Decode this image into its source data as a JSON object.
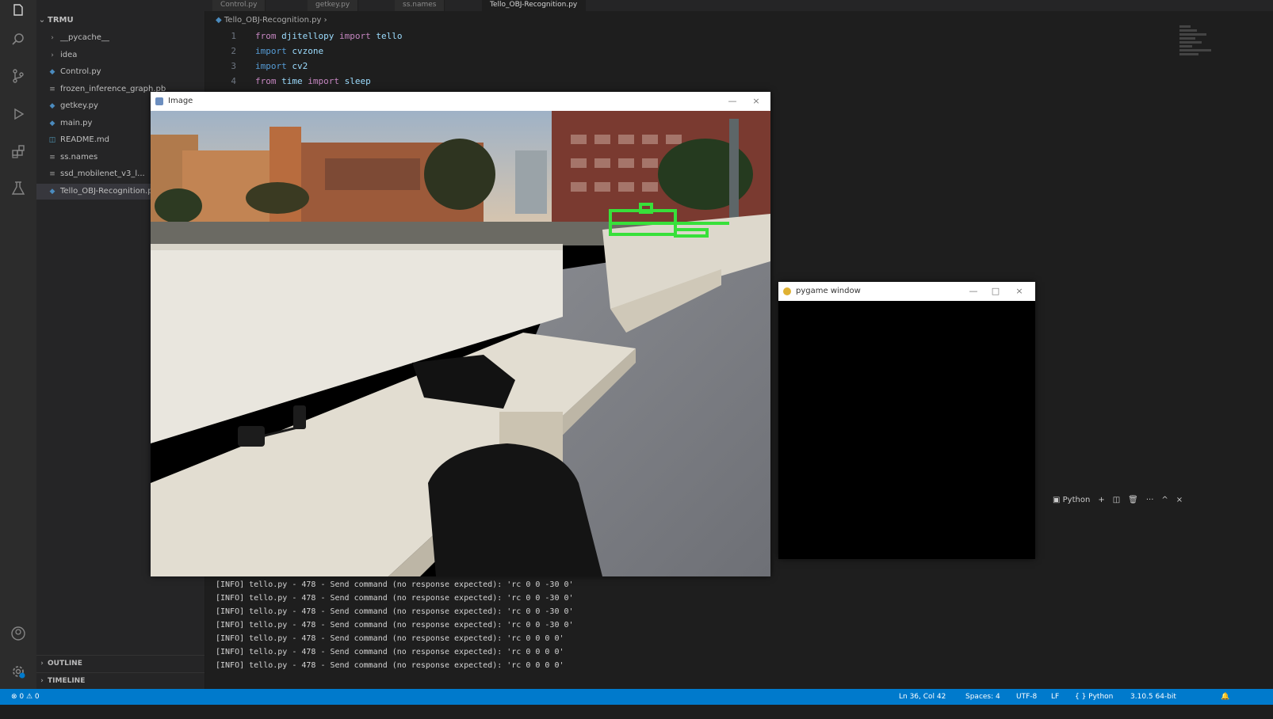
{
  "explorer": {
    "root": "TRMU",
    "items": [
      {
        "label": "__pycache__",
        "icon": "folder-icon",
        "type": "folder"
      },
      {
        "label": "idea",
        "icon": "folder-icon",
        "type": "folder"
      },
      {
        "label": "Control.py",
        "icon": "python-icon",
        "type": "file"
      },
      {
        "label": "frozen_inference_graph.pb",
        "icon": "file-icon",
        "type": "file"
      },
      {
        "label": "getkey.py",
        "icon": "python-icon",
        "type": "file"
      },
      {
        "label": "main.py",
        "icon": "python-icon",
        "type": "file"
      },
      {
        "label": "README.md",
        "icon": "markdown-icon",
        "type": "file"
      },
      {
        "label": "ss.names",
        "icon": "file-icon",
        "type": "file"
      },
      {
        "label": "ssd_mobilenet_v3_l...",
        "icon": "file-icon",
        "type": "file"
      },
      {
        "label": "Tello_OBJ-Recognition.py",
        "icon": "python-icon",
        "type": "file",
        "selected": true
      }
    ],
    "outline_label": "OUTLINE",
    "timeline_label": "TIMELINE"
  },
  "editor": {
    "tabs": [
      {
        "label": "Control.py",
        "active": false
      },
      {
        "label": "getkey.py",
        "active": false
      },
      {
        "label": "ss.names",
        "active": false
      },
      {
        "label": "Tello_OBJ-Recognition.py",
        "active": true
      }
    ],
    "breadcrumb": "Tello_OBJ-Recognition.py",
    "lines": [
      {
        "n": "1",
        "a": "from ",
        "b": "djitellopy",
        "c": " import ",
        "d": "tello"
      },
      {
        "n": "2",
        "a": "import ",
        "b": "cvzone",
        "c": "",
        "d": ""
      },
      {
        "n": "3",
        "a": "import ",
        "b": "cv2",
        "c": "",
        "d": ""
      },
      {
        "n": "4",
        "a": "from ",
        "b": "time",
        "c": " import ",
        "d": "sleep"
      }
    ]
  },
  "terminal": {
    "lines": [
      "[INFO] tello.py - 478 - Send command (no response expected): 'rc 0 0 -30 0'",
      "[INFO] tello.py - 478 - Send command (no response expected): 'rc 0 0 -30 0'",
      "[INFO] tello.py - 478 - Send command (no response expected): 'rc 0 0 -30 0'",
      "[INFO] tello.py - 478 - Send command (no response expected): 'rc 0 0 -30 0'",
      "[INFO] tello.py - 478 - Send command (no response expected): 'rc 0 0 0 0'",
      "[INFO] tello.py - 478 - Send command (no response expected): 'rc 0 0 0 0'",
      "[INFO] tello.py - 478 - Send command (no response expected): 'rc 0 0 0 0'"
    ],
    "toolbar": {
      "shell": "Python",
      "plus": "+",
      "split": "◫",
      "trash": "🗑",
      "more": "···",
      "maximize": "^",
      "close": "×"
    }
  },
  "statusbar": {
    "left": "⊗ 0 ⚠ 0",
    "position": "Ln 36, Col 42",
    "spaces": "Spaces: 4",
    "encoding": "UTF-8",
    "eol": "LF",
    "language": "{ } Python",
    "interpreter": "3.10.5 64-bit"
  },
  "windows": {
    "video": {
      "title": "Image",
      "minimize": "—",
      "close": "×"
    },
    "pygame": {
      "title": "pygame window",
      "minimize": "—",
      "maximize": "□",
      "close": "×"
    }
  },
  "colors": {
    "detection_box": "#38e03a",
    "accent": "#007acc"
  }
}
